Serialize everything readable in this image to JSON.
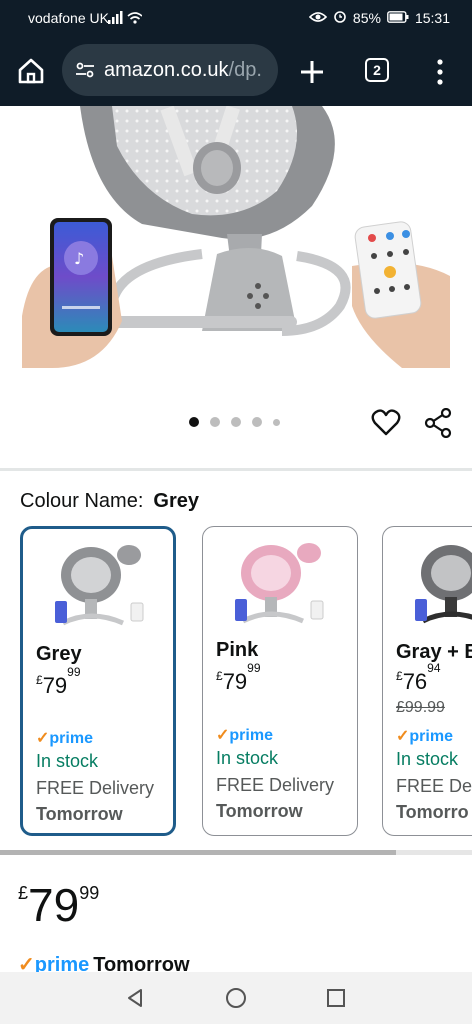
{
  "status_bar": {
    "carrier": "vodafone UK",
    "battery": "85%",
    "time": "15:31"
  },
  "browser": {
    "url_host": "amazon.co.uk",
    "url_path": "/dp.",
    "tab_count": "2"
  },
  "gallery": {
    "image_count": 5,
    "active_index": 0
  },
  "variant": {
    "label": "Colour Name:",
    "selected": "Grey",
    "cards": [
      {
        "name": "Grey",
        "currency": "£",
        "price_whole": "79",
        "price_fraction": "99",
        "was_price": "",
        "prime": "prime",
        "stock": "In stock",
        "delivery": "FREE Delivery",
        "delivery_day": "Tomorrow"
      },
      {
        "name": "Pink",
        "currency": "£",
        "price_whole": "79",
        "price_fraction": "99",
        "was_price": "",
        "prime": "prime",
        "stock": "In stock",
        "delivery": "FREE Delivery",
        "delivery_day": "Tomorrow"
      },
      {
        "name": "Gray + B",
        "currency": "£",
        "price_whole": "76",
        "price_fraction": "94",
        "was_price": "£99.99",
        "prime": "prime",
        "stock": "In stock",
        "delivery": "FREE Deli",
        "delivery_day": "Tomorro"
      }
    ]
  },
  "price": {
    "currency": "£",
    "whole": "79",
    "fraction": "99"
  },
  "delivery": {
    "prime": "prime",
    "day": "Tomorrow"
  },
  "colors": {
    "browser_bar": "#0f1c28",
    "prime_blue": "#1a98ff",
    "stock_green": "#067d62",
    "selected_border": "#1f5c8a"
  }
}
